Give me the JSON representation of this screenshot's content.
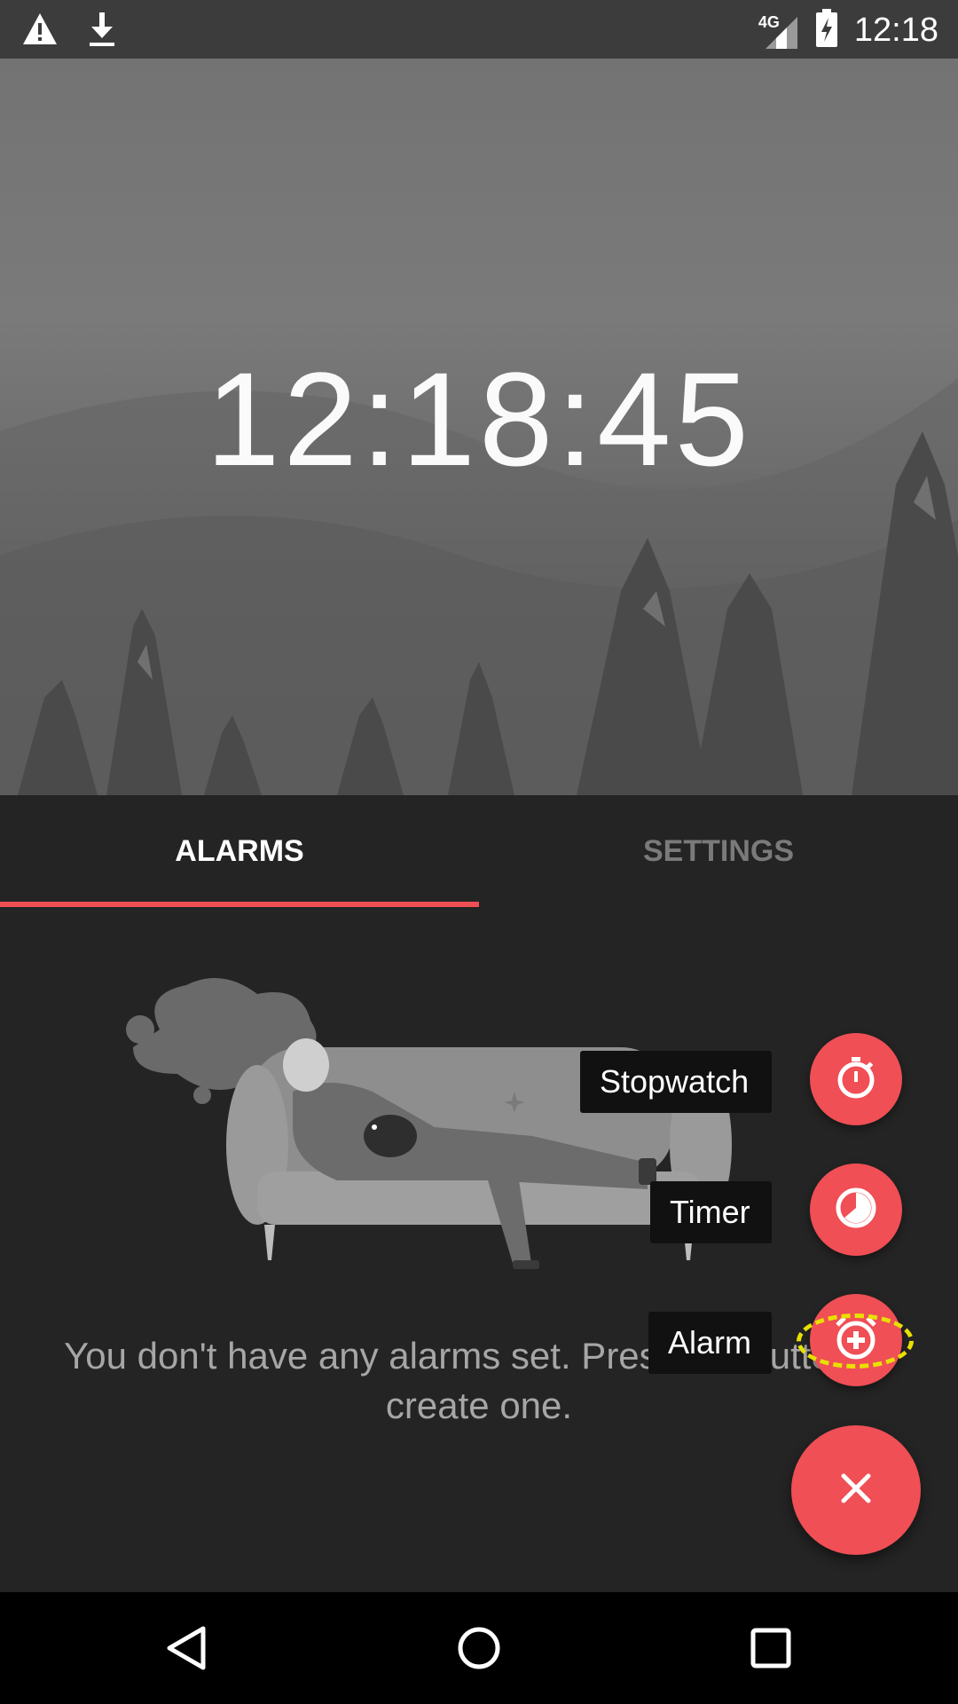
{
  "status_bar": {
    "time": "12:18",
    "network": "4G",
    "icons": [
      "warning-icon",
      "download-icon",
      "signal-icon",
      "battery-charging-icon"
    ]
  },
  "header": {
    "clock": "12:18:45"
  },
  "tabs": [
    {
      "label": "ALARMS",
      "selected": true
    },
    {
      "label": "SETTINGS",
      "selected": false
    }
  ],
  "empty_state": {
    "message": "You don't have any alarms set. Press the button to create one."
  },
  "fab_menu": {
    "items": [
      {
        "label": "Stopwatch",
        "icon": "stopwatch-icon"
      },
      {
        "label": "Timer",
        "icon": "timer-icon"
      },
      {
        "label": "Alarm",
        "icon": "add-alarm-icon"
      }
    ],
    "close_icon": "close-icon"
  },
  "colors": {
    "accent": "#ef4f55",
    "background": "#242424",
    "highlight": "#e8e000"
  },
  "navigation": {
    "icons": [
      "back-icon",
      "home-icon",
      "recents-icon"
    ]
  }
}
